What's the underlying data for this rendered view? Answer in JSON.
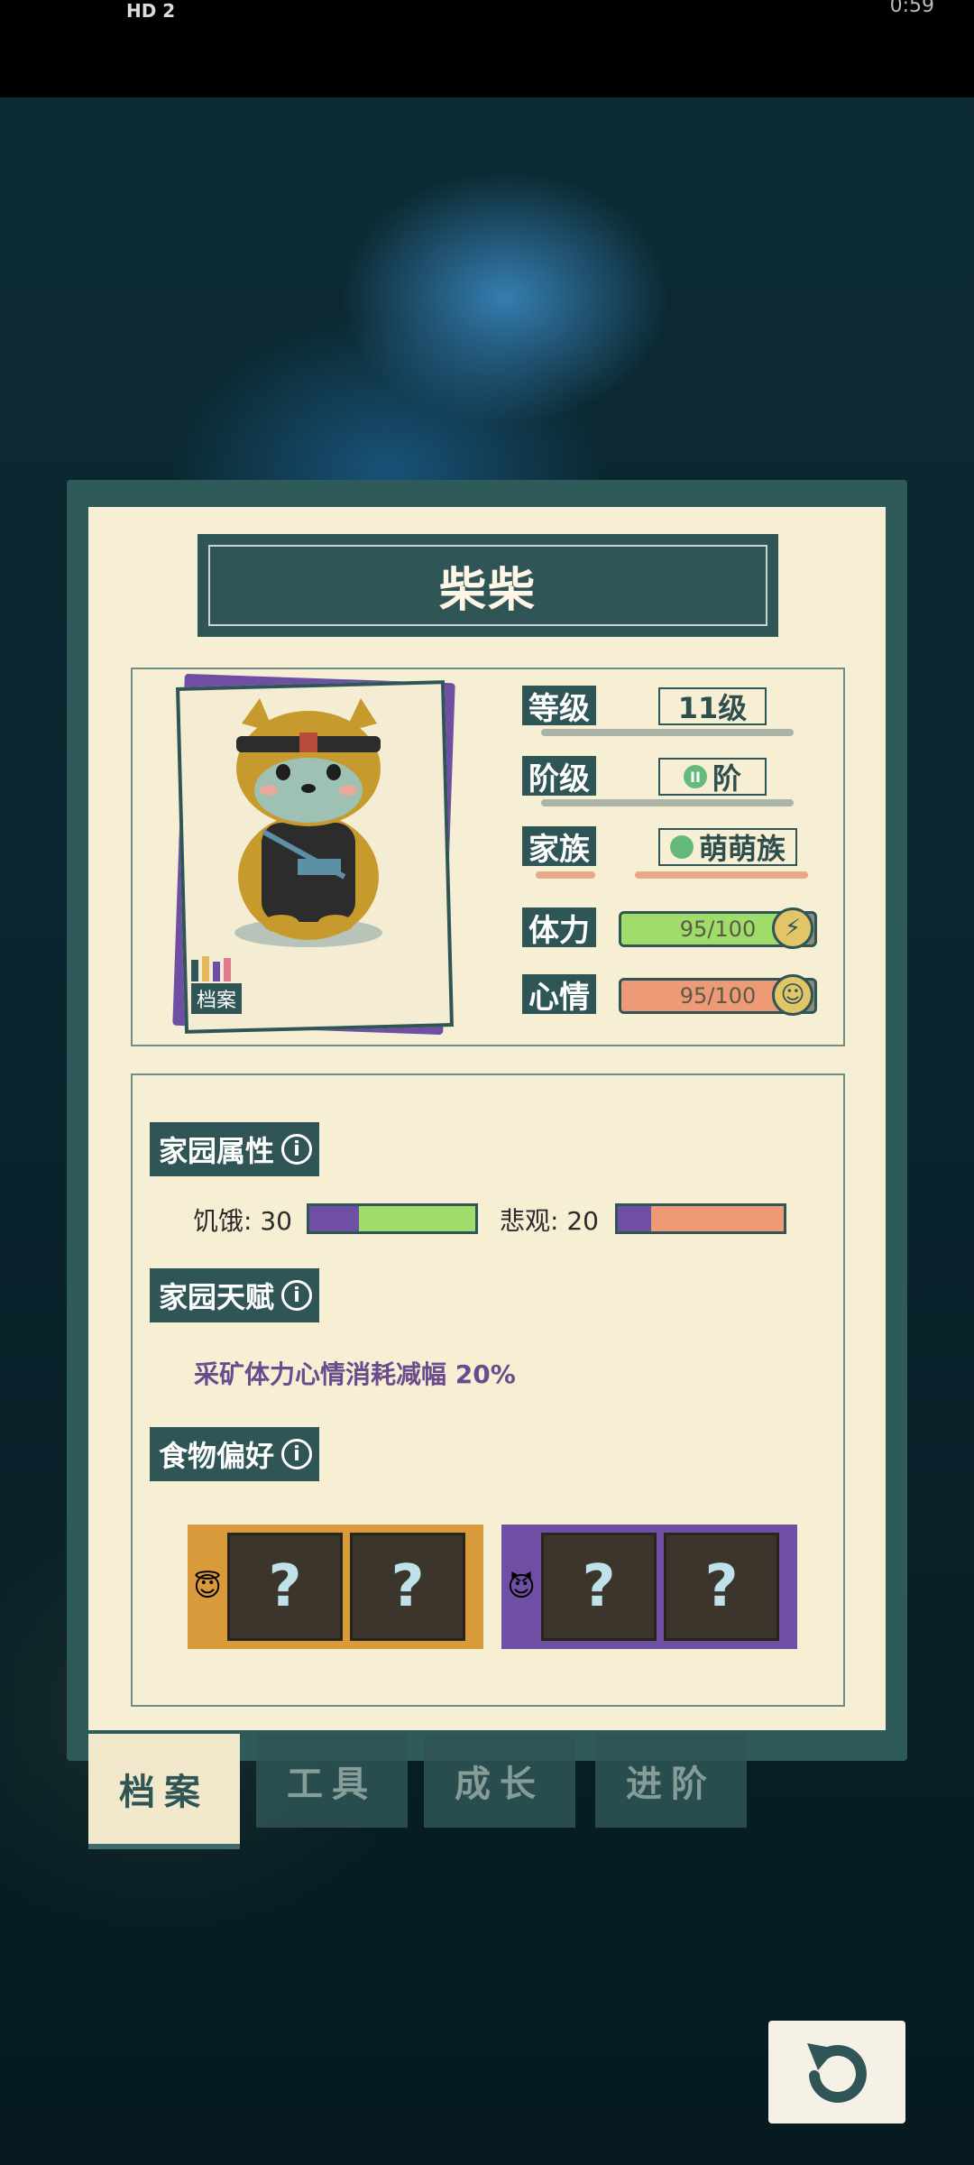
{
  "status_bar": {
    "left": "HD 2",
    "right": "0:59"
  },
  "character": {
    "name": "柴柴",
    "archive_tag": "档案"
  },
  "stats": {
    "level_label": "等级",
    "level_value": "11级",
    "rank_label": "阶级",
    "rank_value": "阶",
    "rank_icon_text": "II",
    "clan_label": "家族",
    "clan_value": "萌萌族",
    "stamina_label": "体力",
    "stamina_value": "95/100",
    "stamina_fraction": 0.95,
    "mood_label": "心情",
    "mood_value": "95/100",
    "mood_fraction": 0.95
  },
  "home_attributes": {
    "title": "家园属性",
    "hunger_label": "饥饿: 30",
    "hunger_value": 30,
    "pessimism_label": "悲观: 20",
    "pessimism_value": 20
  },
  "home_talent": {
    "title": "家园天赋",
    "text": "采矿体力心情消耗减幅 20%"
  },
  "food_preference": {
    "title": "食物偏好",
    "likes": [
      "?",
      "?"
    ],
    "dislikes": [
      "?",
      "?"
    ]
  },
  "tabs": [
    {
      "label": "档案",
      "active": true
    },
    {
      "label": "工具",
      "active": false
    },
    {
      "label": "成长",
      "active": false
    },
    {
      "label": "进阶",
      "active": false
    }
  ],
  "colors": {
    "panel": "#2f5556",
    "paper": "#f7efd3",
    "stamina": "#9fdc6a",
    "mood": "#ee9a76",
    "purple": "#6e4fa3",
    "like_box": "#d99a3c"
  }
}
